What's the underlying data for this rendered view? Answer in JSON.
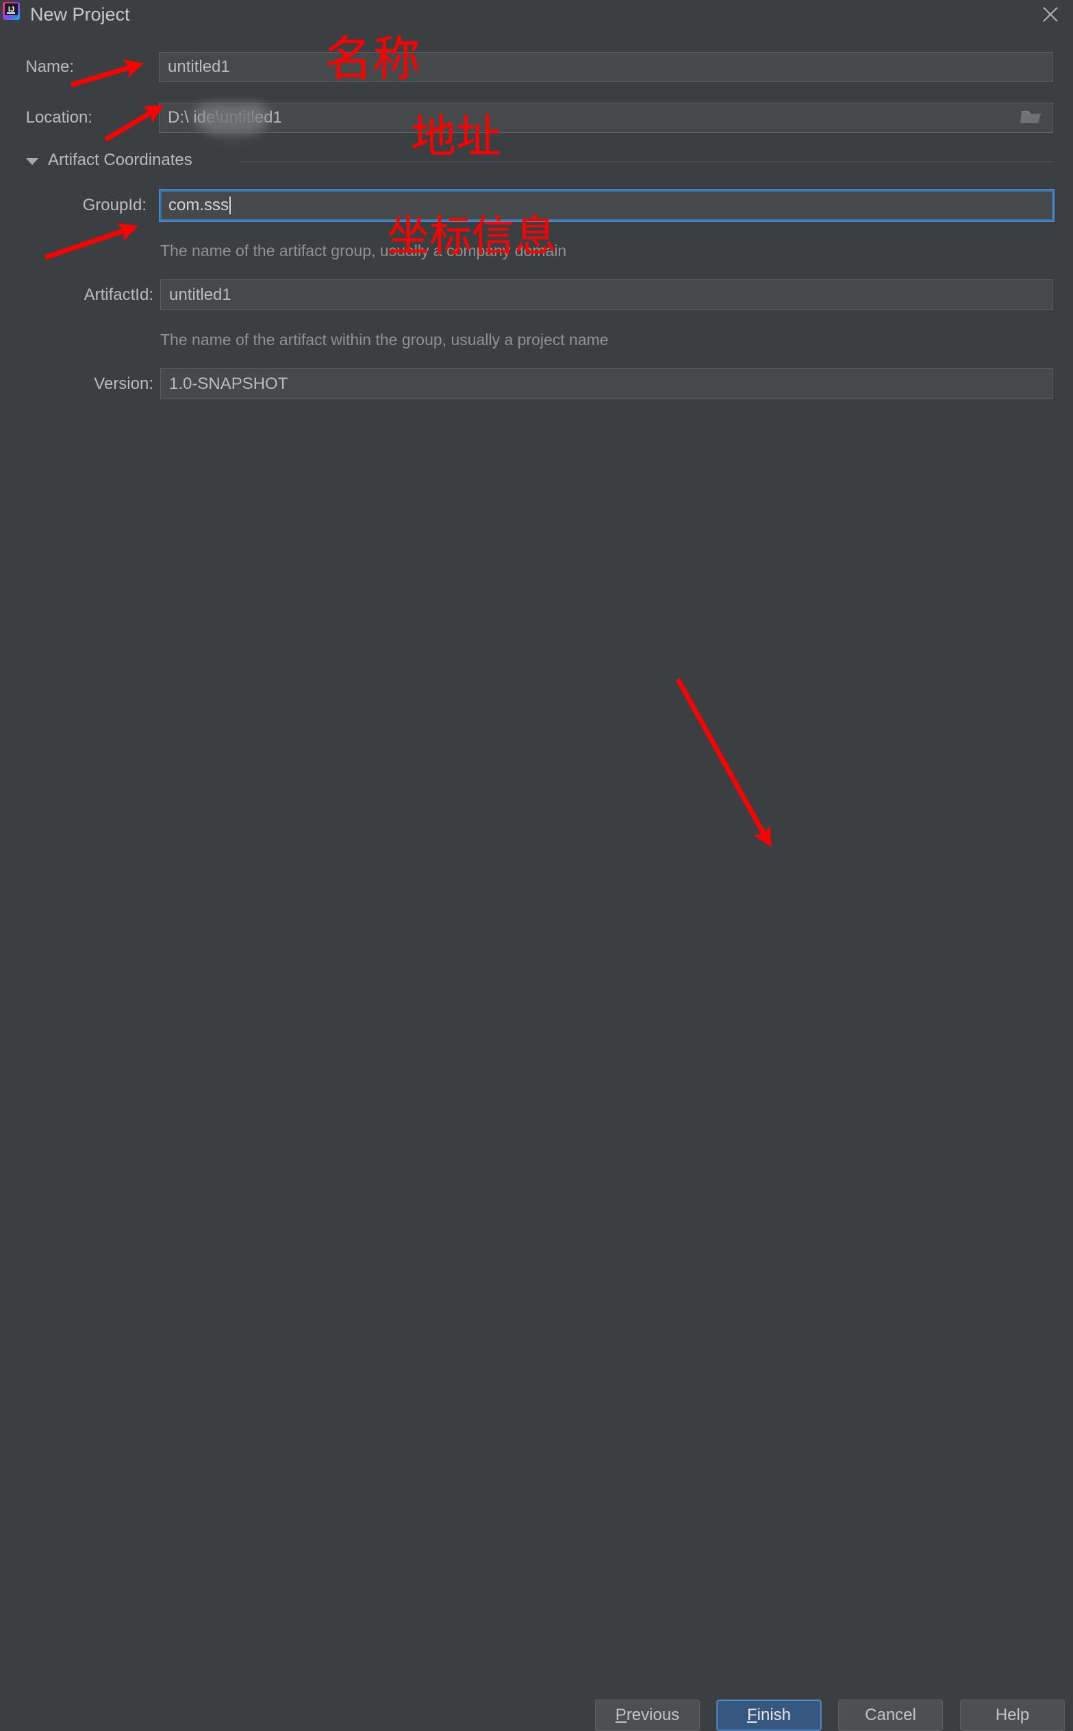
{
  "window": {
    "title": "New Project",
    "app_icon": "intellij-idea-icon",
    "icon_text": "IJ",
    "close_icon": "close-icon"
  },
  "form": {
    "name": {
      "label": "Name:",
      "value": "untitled1",
      "placeholder": "untitled1"
    },
    "location": {
      "label": "Location:",
      "value": "D:\\            ide\\untitled1",
      "browse_icon": "folder-icon"
    },
    "artifact_section": {
      "label": "Artifact Coordinates",
      "expanded": true,
      "toggle_icon": "chevron-down-icon"
    },
    "group_id": {
      "label": "GroupId:",
      "value": "com.sss",
      "focused": true,
      "hint": "The name of the artifact group, usually a company domain"
    },
    "artifact_id": {
      "label": "ArtifactId:",
      "value": "untitled1",
      "hint": "The name of the artifact within the group, usually a project name"
    },
    "version": {
      "label": "Version:",
      "value": "1.0-SNAPSHOT"
    }
  },
  "footer": {
    "previous": {
      "label": "Previous",
      "mnemonic": "P",
      "rest": "revious"
    },
    "finish": {
      "label": "Finish",
      "mnemonic": "F",
      "rest": "inish",
      "primary": true
    },
    "cancel": {
      "label": "Cancel"
    },
    "help": {
      "label": "Help"
    }
  },
  "annotations": {
    "color": "#ff0000",
    "labels": [
      {
        "text": "名称",
        "meaning": "name"
      },
      {
        "text": "地址",
        "meaning": "location"
      },
      {
        "text": "坐标信息",
        "meaning": "coordinate-information"
      }
    ],
    "arrows": 4
  },
  "colors": {
    "dialog_background": "#3c3f41",
    "input_background": "#45494a",
    "input_border": "#5e6060",
    "focus_border": "#4a88c7",
    "primary_button": "#365880",
    "text": "#bbbbbb",
    "hint_text": "#919191",
    "annotation_red": "#ff0000"
  }
}
